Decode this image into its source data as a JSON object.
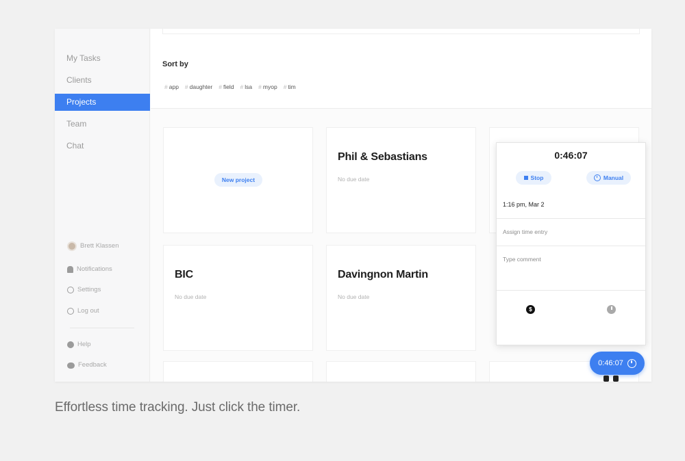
{
  "sidebar": {
    "nav": [
      {
        "label": "My Tasks"
      },
      {
        "label": "Clients"
      },
      {
        "label": "Projects",
        "active": true
      },
      {
        "label": "Team"
      },
      {
        "label": "Chat"
      }
    ],
    "user": "Brett Klassen",
    "notifications": "Notifications",
    "settings": "Settings",
    "logout": "Log out",
    "help": "Help",
    "feedback": "Feedback"
  },
  "main": {
    "sort_label": "Sort by",
    "tags": [
      "app",
      "daughter",
      "field",
      "lsa",
      "myop",
      "tim"
    ],
    "new_project": "New project",
    "cards": [
      {
        "title": "Phil & Sebastians",
        "due": "No due date"
      },
      {
        "title": "BIC",
        "due": "No due date"
      },
      {
        "title": "Davingnon Martin",
        "due": "No due date"
      }
    ]
  },
  "timer_panel": {
    "time": "0:46:07",
    "stop_label": "Stop",
    "manual_label": "Manual",
    "date": "1:16 pm, Mar 2",
    "assign_placeholder": "Assign time entry",
    "comment_placeholder": "Type comment",
    "dollar_symbol": "$"
  },
  "floating_timer": {
    "time": "0:46:07"
  },
  "caption": "Effortless time tracking. Just click the timer.",
  "colors": {
    "accent": "#3d7ff0",
    "pill_bg": "#e9f1fd",
    "background": "#f1f1f1"
  }
}
